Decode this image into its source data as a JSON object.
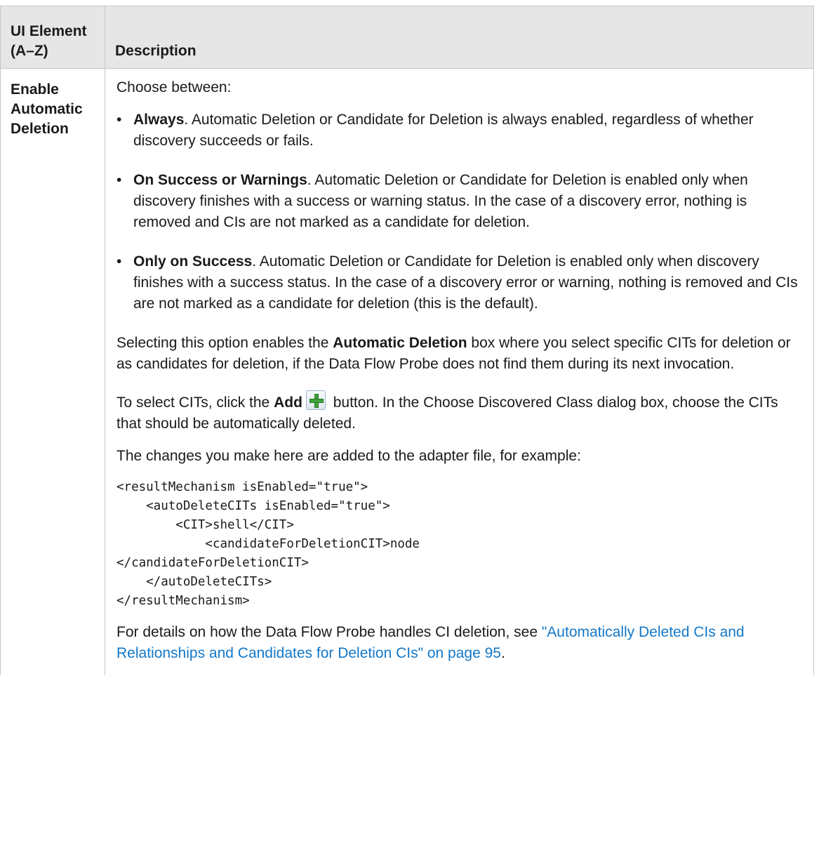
{
  "table": {
    "headers": {
      "ui_element": "UI Element (A–Z)",
      "description": "Description"
    },
    "row": {
      "element_name": "Enable Automatic Deletion",
      "intro": "Choose between:",
      "options": [
        {
          "term": "Always",
          "text": ". Automatic Deletion or Candidate for Deletion is always enabled, regardless of whether discovery succeeds or fails."
        },
        {
          "term": "On Success or Warnings",
          "text": ". Automatic Deletion or Candidate for Deletion is enabled only when discovery finishes with a success or warning status. In the case of a discovery error, nothing is removed and CIs are not marked as a candidate for deletion."
        },
        {
          "term": "Only on Success",
          "text": ". Automatic Deletion or Candidate for Deletion is enabled only when discovery finishes with a success status. In the case of a discovery error or warning, nothing is removed and CIs are not marked as a candidate for deletion (this is the default)."
        }
      ],
      "selecting_pre": "Selecting this option enables the ",
      "selecting_bold": "Automatic Deletion",
      "selecting_post": " box where you select specific CITs for deletion or as candidates for deletion, if the Data Flow Probe does not find them during its next invocation.",
      "add_pre": "To select CITs, click the ",
      "add_bold": "Add",
      "add_icon": "add-icon",
      "add_post": " button. In the Choose Discovered Class dialog box, choose the CITs that should be automatically deleted.",
      "changes_text": "The changes you make here are added to the adapter file, for example:",
      "code": "<resultMechanism isEnabled=\"true\">\n    <autoDeleteCITs isEnabled=\"true\">\n        <CIT>shell</CIT>\n            <candidateForDeletionCIT>node\n</candidateForDeletionCIT>\n    </autoDeleteCITs>\n</resultMechanism>",
      "details_pre": "For details on how the Data Flow Probe handles CI deletion, see ",
      "details_link": "\"Automatically Deleted CIs and Relationships and Candidates for Deletion CIs\" on page 95",
      "details_post": "."
    }
  },
  "colors": {
    "header_bg": "#e6e6e6",
    "border": "#c6c6c6",
    "link": "#1478c8"
  }
}
